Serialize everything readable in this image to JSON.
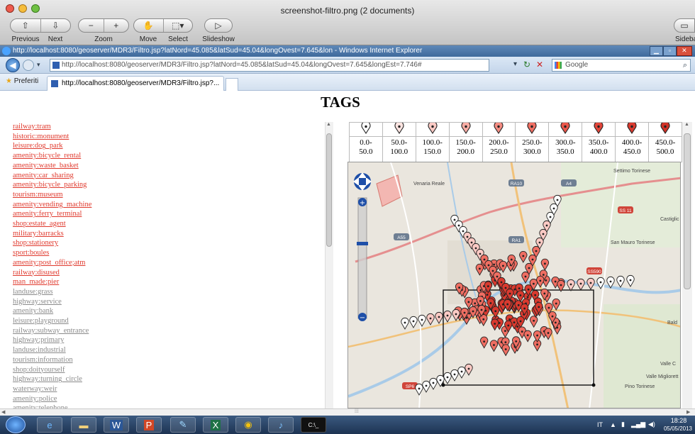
{
  "preview_window": {
    "title": "screenshot-filtro.png (2 documents)",
    "toolbar": {
      "previous_label": "Previous",
      "next_label": "Next",
      "zoom_label": "Zoom",
      "move_label": "Move",
      "select_label": "Select",
      "slideshow_label": "Slideshow",
      "sidebar_label": "Sideba"
    }
  },
  "browser": {
    "title": "http://localhost:8080/geoserver/MDR3/Filtro.jsp?latNord=45.085&latSud=45.04&longOvest=7.645&lon - Windows Internet Explorer",
    "address": "http://localhost:8080/geoserver/MDR3/Filtro.jsp?latNord=45.085&latSud=45.04&longOvest=7.645&longEst=7.746#",
    "search_placeholder": "Google",
    "favorites_label": "Preferiti",
    "tab_label": "http://localhost:8080/geoserver/MDR3/Filtro.jsp?..."
  },
  "page": {
    "title": "TAGS",
    "tags": [
      {
        "label": "railway:tram",
        "active": true
      },
      {
        "label": "historic:monument",
        "active": true
      },
      {
        "label": "leisure:dog_park",
        "active": true
      },
      {
        "label": "amenity:bicycle_rental",
        "active": true
      },
      {
        "label": "amenity:waste_basket",
        "active": true
      },
      {
        "label": "amenity:car_sharing",
        "active": true
      },
      {
        "label": "amenity:bicycle_parking",
        "active": true
      },
      {
        "label": "tourism:museum",
        "active": true
      },
      {
        "label": "amenity:vending_machine",
        "active": true
      },
      {
        "label": "amenity:ferry_terminal",
        "active": true
      },
      {
        "label": "shop:estate_agent",
        "active": true
      },
      {
        "label": "military:barracks",
        "active": true
      },
      {
        "label": "shop:stationery",
        "active": true
      },
      {
        "label": "sport:boules",
        "active": true
      },
      {
        "label": "amenity:post_office;atm",
        "active": true
      },
      {
        "label": "railway:disused",
        "active": true
      },
      {
        "label": "man_made:pier",
        "active": true
      },
      {
        "label": "landuse:grass",
        "active": false
      },
      {
        "label": "highway:service",
        "active": false
      },
      {
        "label": "amenity:bank",
        "active": false
      },
      {
        "label": "leisure:playground",
        "active": false
      },
      {
        "label": "railway:subway_entrance",
        "active": false
      },
      {
        "label": "highway:primary",
        "active": false
      },
      {
        "label": "landuse:industrial",
        "active": false
      },
      {
        "label": "tourism:information",
        "active": false
      },
      {
        "label": "shop:doityourself",
        "active": false
      },
      {
        "label": "highway:turning_circle",
        "active": false
      },
      {
        "label": "waterway:weir",
        "active": false
      },
      {
        "label": "amenity:police",
        "active": false
      },
      {
        "label": "amenity:telephone",
        "active": false
      }
    ],
    "legend": [
      {
        "line1": "0.0-",
        "line2": "50.0",
        "fill": "#ffffff"
      },
      {
        "line1": "50.0-",
        "line2": "100.0",
        "fill": "#fde4e1"
      },
      {
        "line1": "100.0-",
        "line2": "150.0",
        "fill": "#fbcac4"
      },
      {
        "line1": "150.0-",
        "line2": "200.0",
        "fill": "#f8aca4"
      },
      {
        "line1": "200.0-",
        "line2": "250.0",
        "fill": "#f48c82"
      },
      {
        "line1": "250.0-",
        "line2": "300.0",
        "fill": "#ef6e62"
      },
      {
        "line1": "300.0-",
        "line2": "350.0",
        "fill": "#e9564a"
      },
      {
        "line1": "350.0-",
        "line2": "400.0",
        "fill": "#e2463a"
      },
      {
        "line1": "400.0-",
        "line2": "450.0",
        "fill": "#d93a2f"
      },
      {
        "line1": "450.0-",
        "line2": "500.0",
        "fill": "#cf3126"
      }
    ],
    "map_labels": [
      "Venaria Reale",
      "Settimo Torinese",
      "San Mauro Torinese",
      "Castiglic",
      "Bald",
      "Valle C",
      "Valle Migliorett",
      "Pino Torinese"
    ],
    "road_badges": [
      "RA10",
      "A4",
      "SS 11",
      "A55",
      "RA1",
      "SS590",
      "SP6"
    ]
  },
  "taskbar": {
    "language": "IT",
    "time": "18:28",
    "date": "05/05/2013"
  },
  "colors": {
    "active_tag": "#e03a2e",
    "inactive_tag": "#8a8a8a",
    "marker_red": "#e2463a"
  }
}
